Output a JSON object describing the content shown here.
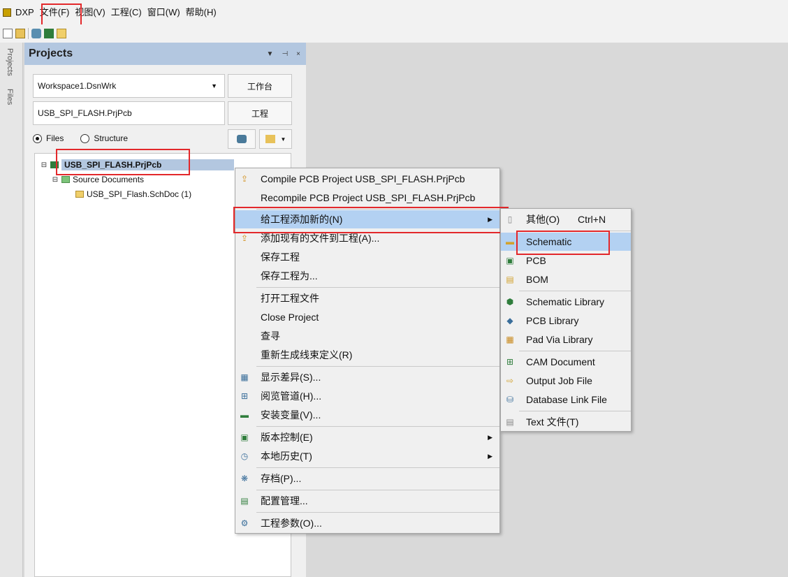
{
  "menubar": {
    "items": [
      "DXP",
      "文件(F)",
      "视图(V)",
      "工程(C)",
      "窗口(W)",
      "帮助(H)"
    ]
  },
  "side_tabs": [
    "Projects",
    "Files"
  ],
  "panel": {
    "title": "Projects",
    "controls": [
      "▼",
      "⊣",
      "×"
    ],
    "workspace_value": "Workspace1.DsnWrk",
    "workspace_button": "工作台",
    "project_value": "USB_SPI_FLASH.PrjPcb",
    "project_button": "工程",
    "radio_files": "Files",
    "radio_structure": "Structure",
    "tree": {
      "root": "USB_SPI_FLASH.PrjPcb",
      "folder": "Source Documents",
      "doc": "USB_SPI_Flash.SchDoc (1)"
    }
  },
  "context_menu": {
    "items": [
      "Compile PCB Project USB_SPI_FLASH.PrjPcb",
      "Recompile PCB Project USB_SPI_FLASH.PrjPcb",
      "给工程添加新的(N)",
      "添加现有的文件到工程(A)...",
      "保存工程",
      "保存工程为...",
      "打开工程文件",
      "Close Project",
      "查寻",
      "重新生成线束定义(R)",
      "显示差异(S)...",
      "阅览管道(H)...",
      "安装变量(V)...",
      "版本控制(E)",
      "本地历史(T)",
      "存档(P)...",
      "配置管理...",
      "工程参数(O)..."
    ]
  },
  "submenu": {
    "other_label": "其他(O)",
    "other_shortcut": "Ctrl+N",
    "items": [
      "Schematic",
      "PCB",
      "BOM",
      "Schematic Library",
      "PCB Library",
      "Pad Via Library",
      "CAM Document",
      "Output Job File",
      "Database Link File",
      "Text  文件(T)"
    ]
  },
  "colors": {
    "highlight_box": "#e3282b",
    "hover": "#b3d1f2",
    "panel_header": "#b3c7e0"
  }
}
